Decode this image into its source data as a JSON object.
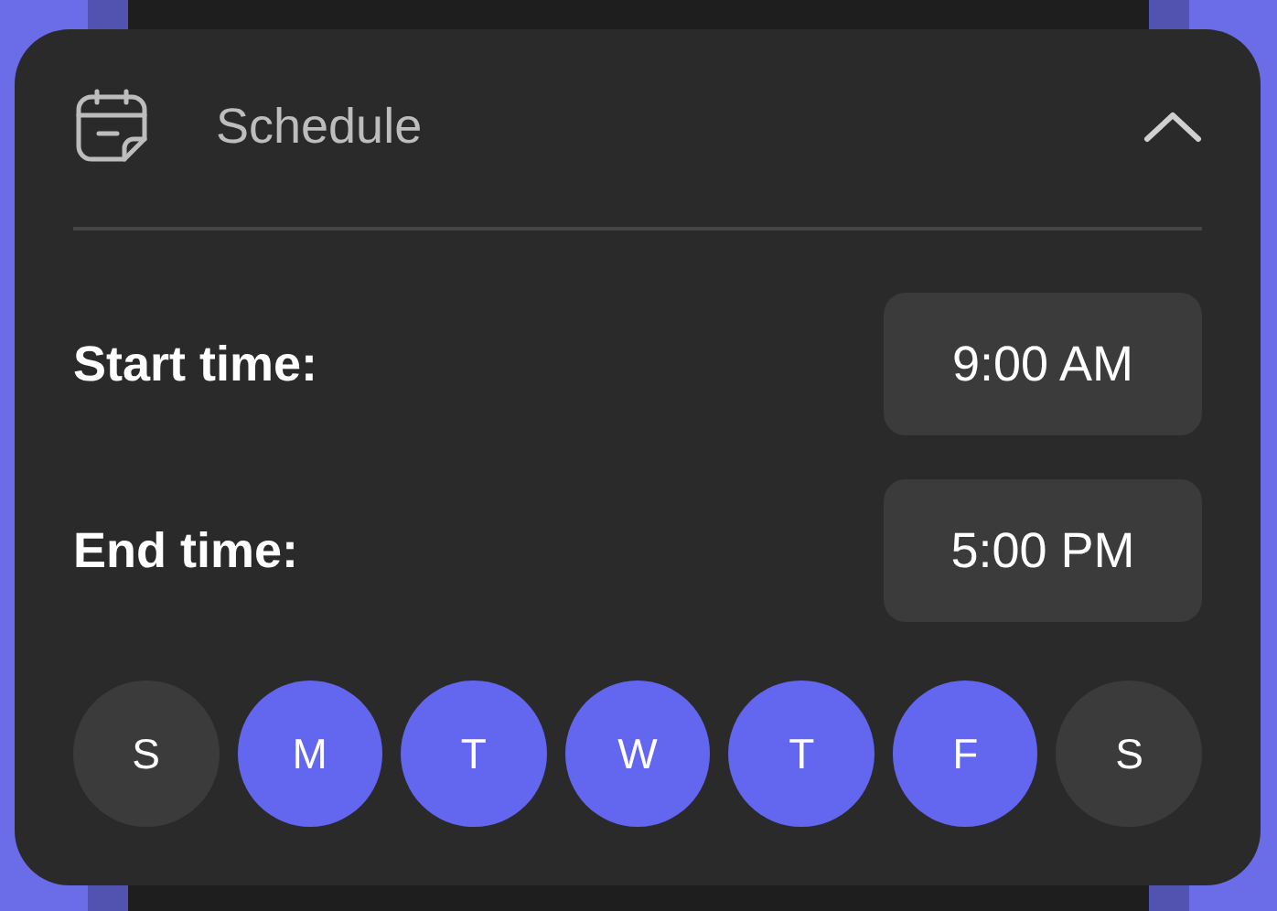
{
  "section": {
    "title": "Schedule",
    "expanded": true
  },
  "fields": [
    {
      "label": "Start time:",
      "value": "9:00 AM"
    },
    {
      "label": "End time:",
      "value": "5:00 PM"
    }
  ],
  "days": [
    {
      "label": "S",
      "selected": false
    },
    {
      "label": "M",
      "selected": true
    },
    {
      "label": "T",
      "selected": true
    },
    {
      "label": "W",
      "selected": true
    },
    {
      "label": "T",
      "selected": true
    },
    {
      "label": "F",
      "selected": true
    },
    {
      "label": "S",
      "selected": false
    }
  ]
}
